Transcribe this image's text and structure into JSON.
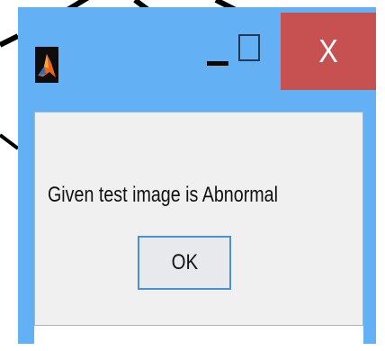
{
  "window": {
    "title_bar_color": "#64b0f4",
    "app_icon": "matlab-logo-icon",
    "controls": {
      "minimize_icon": "minimize-icon",
      "maximize_icon": "maximize-icon",
      "close_label": "X",
      "close_color": "#c75050"
    }
  },
  "dialog": {
    "message": "Given test image is Abnormal",
    "ok_label": "OK",
    "button_border_color": "#4a90d9"
  }
}
